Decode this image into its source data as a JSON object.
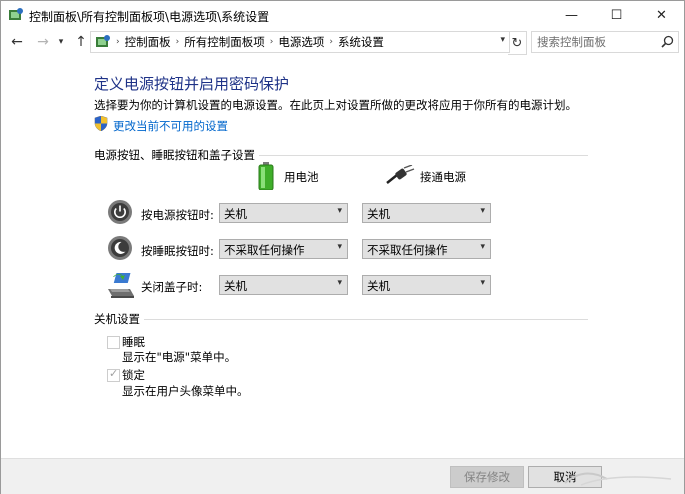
{
  "window": {
    "title": "控制面板\\所有控制面板项\\电源选项\\系统设置",
    "minimize_glyph": "—",
    "maximize_glyph": "☐",
    "close_glyph": "✕"
  },
  "nav": {
    "back_glyph": "←",
    "forward_glyph": "→",
    "dropdown_glyph": "▾",
    "up_glyph": "↑",
    "breadcrumb": [
      "控制面板",
      "所有控制面板项",
      "电源选项",
      "系统设置"
    ],
    "breadcrumb_sep": "›",
    "refresh_glyph": "↻",
    "search_placeholder": "搜索控制面板"
  },
  "page": {
    "title": "定义电源按钮并启用密码保护",
    "description": "选择要为你的计算机设置的电源设置。在此页上对设置所做的更改将应用于你所有的电源计划。",
    "change_link": "更改当前不可用的设置"
  },
  "buttons_section": {
    "title": "电源按钮、睡眠按钮和盖子设置",
    "col_battery": "用电池",
    "col_plugged": "接通电源",
    "rows": [
      {
        "label": "按电源按钮时:",
        "icon": "power-button-icon",
        "battery": "关机",
        "plugged": "关机"
      },
      {
        "label": "按睡眠按钮时:",
        "icon": "sleep-button-icon",
        "battery": "不采取任何操作",
        "plugged": "不采取任何操作"
      },
      {
        "label": "关闭盖子时:",
        "icon": "laptop-lid-icon",
        "battery": "关机",
        "plugged": "关机"
      }
    ]
  },
  "shutdown_section": {
    "title": "关机设置",
    "items": [
      {
        "label": "睡眠",
        "sub": "显示在\"电源\"菜单中。",
        "checked": false
      },
      {
        "label": "锁定",
        "sub": "显示在用户头像菜单中。",
        "checked": true
      }
    ]
  },
  "footer": {
    "save_label": "保存修改",
    "cancel_label": "取消"
  },
  "colors": {
    "heading": "#1e3287",
    "link": "#0066cc",
    "footer_bg": "#f0f0f0"
  }
}
